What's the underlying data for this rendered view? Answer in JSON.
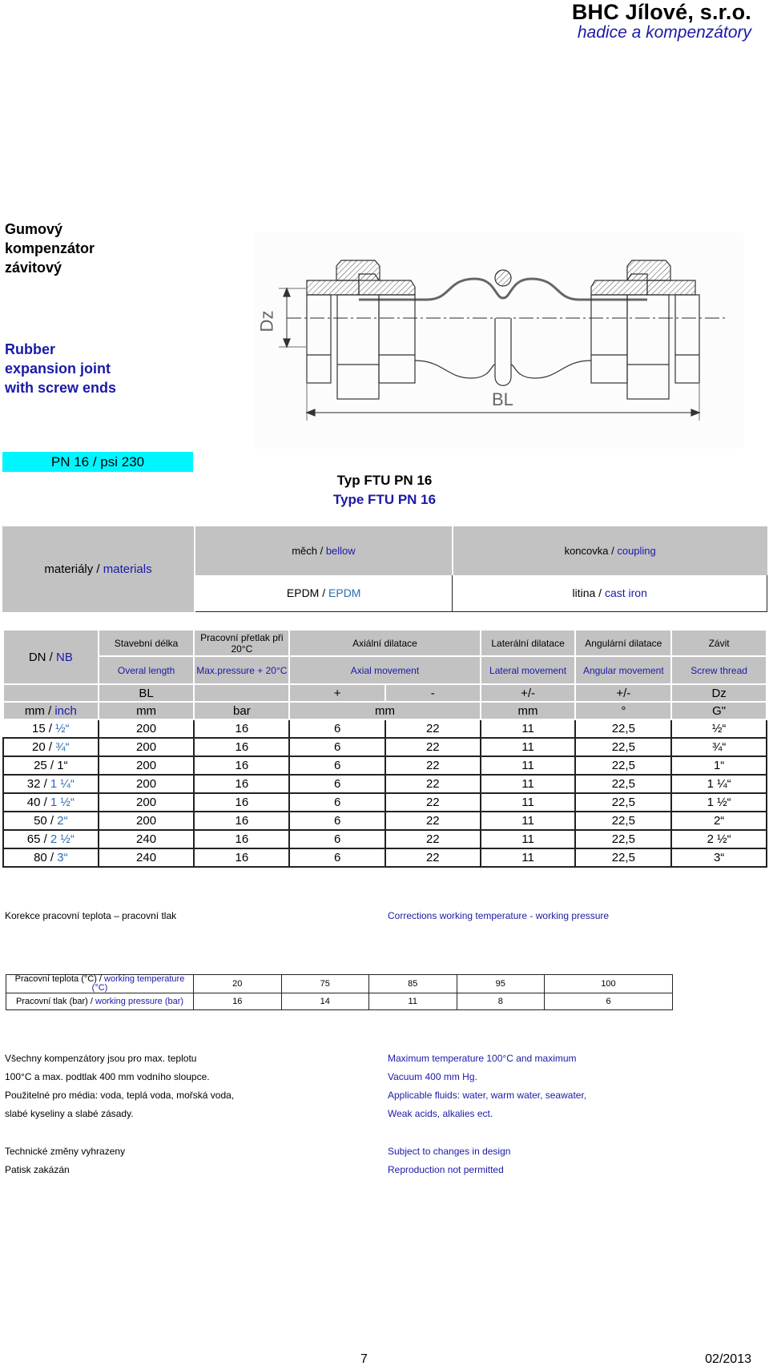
{
  "header": {
    "company": "BHC Jílové, s.r.o.",
    "tagline": "hadice a kompenzátory"
  },
  "product": {
    "title_cz": [
      "Gumový",
      "kompenzátor",
      "závitový"
    ],
    "title_en": [
      "Rubber",
      "expansion joint",
      "with screw ends"
    ],
    "drawing_labels": {
      "dz": "Dz",
      "bl": "BL"
    },
    "pn_badge": "PN 16 / psi 230",
    "type_cz": "Typ FTU PN 16",
    "type_en": "Type FTU PN 16"
  },
  "materials": {
    "label_cz": "materiály / ",
    "label_en": "materials",
    "cols": [
      {
        "head_cz": "měch / ",
        "head_en": "bellow",
        "val_cz": "EPDM / ",
        "val_en": "EPDM"
      },
      {
        "head_cz": "koncovka / ",
        "head_en": "coupling",
        "val_cz": "litina / ",
        "val_en": "cast iron"
      }
    ]
  },
  "spec": {
    "dn_cz": "DN / ",
    "dn_en": "NB",
    "headers_cz": [
      "Stavební délka",
      "Pracovní přetlak při 20°C",
      "Axiální dilatace",
      "Laterální dilatace",
      "Angulární dilatace",
      "Závit"
    ],
    "headers_en": [
      "Overal length",
      "Max.pressure + 20°C",
      "Axial movement",
      "Lateral movement",
      "Angular movement",
      "Screw thread"
    ],
    "symbols": [
      "BL",
      "",
      "+",
      "-",
      "+/-",
      "+/-",
      "Dz"
    ],
    "units_first_cz": "mm / ",
    "units_first_en": "inch",
    "units": [
      "mm",
      "bar",
      "mm",
      "mm",
      "°",
      "G\""
    ],
    "rows": [
      {
        "dn": "15 / ",
        "inch": "½“",
        "bl": "200",
        "bar": "16",
        "ax_plus": "6",
        "ax_minus": "22",
        "lat": "11",
        "ang": "22,5",
        "thread": "½“"
      },
      {
        "dn": "20 / ",
        "inch": "¾“",
        "bl": "200",
        "bar": "16",
        "ax_plus": "6",
        "ax_minus": "22",
        "lat": "11",
        "ang": "22,5",
        "thread": "¾“"
      },
      {
        "dn": "25 / 1“",
        "inch": "",
        "bl": "200",
        "bar": "16",
        "ax_plus": "6",
        "ax_minus": "22",
        "lat": "11",
        "ang": "22,5",
        "thread": "1“"
      },
      {
        "dn": "32 / ",
        "inch": "1 ¼“",
        "bl": "200",
        "bar": "16",
        "ax_plus": "6",
        "ax_minus": "22",
        "lat": "11",
        "ang": "22,5",
        "thread": "1 ¼“"
      },
      {
        "dn": "40 / ",
        "inch": "1 ½“",
        "bl": "200",
        "bar": "16",
        "ax_plus": "6",
        "ax_minus": "22",
        "lat": "11",
        "ang": "22,5",
        "thread": "1 ½“"
      },
      {
        "dn": "50 / ",
        "inch": "2“",
        "bl": "200",
        "bar": "16",
        "ax_plus": "6",
        "ax_minus": "22",
        "lat": "11",
        "ang": "22,5",
        "thread": "2“"
      },
      {
        "dn": "65 / ",
        "inch": "2 ½“",
        "bl": "240",
        "bar": "16",
        "ax_plus": "6",
        "ax_minus": "22",
        "lat": "11",
        "ang": "22,5",
        "thread": "2 ½“"
      },
      {
        "dn": "80 / ",
        "inch": "3“",
        "bl": "240",
        "bar": "16",
        "ax_plus": "6",
        "ax_minus": "22",
        "lat": "11",
        "ang": "22,5",
        "thread": "3“"
      }
    ]
  },
  "corrections": {
    "title_cz": "Korekce pracovní teplota  – pracovní tlak",
    "title_en": "Corrections  working temperature - working pressure",
    "temp_label_cz": "Pracovní teplota (°C) / ",
    "temp_label_en": "working temperature (°C)",
    "press_label_cz": "Pracovní tlak  (bar) / ",
    "press_label_en": "working pressure (bar)",
    "temps": [
      "20",
      "75",
      "85",
      "95",
      "100"
    ],
    "pressures": [
      "16",
      "14",
      "11",
      "8",
      "6"
    ]
  },
  "notes": {
    "cz": [
      "Všechny kompenzátory jsou pro max. teplotu",
      "100°C  a max. podtlak 400 mm vodního sloupce.",
      "Použitelné pro média: voda, teplá voda, mořská voda,",
      "slabé kyseliny a slabé zásady."
    ],
    "en": [
      "Maximum temperature 100°C and maximum",
      "Vacuum 400 mm Hg.",
      "Applicable fluids: water, warm water, seawater,",
      "Weak acids, alkalies ect."
    ],
    "legal_cz": [
      "Technické změny vyhrazeny",
      "Patisk zakázán"
    ],
    "legal_en": [
      "Subject to changes in design",
      "Reproduction not permitted"
    ]
  },
  "footer": {
    "page": "7",
    "date": "02/2013"
  }
}
